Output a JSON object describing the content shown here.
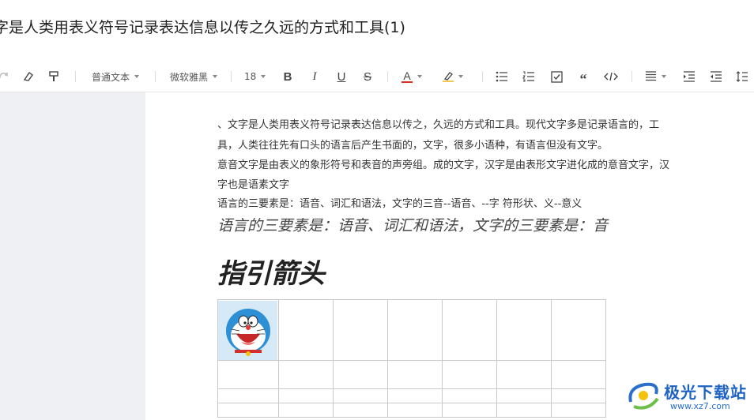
{
  "document": {
    "title": "字是人类用表义符号记录表达信息以传之久远的方式和工具(1)"
  },
  "toolbar": {
    "paragraph_style": "普通文本",
    "font_family": "微软雅黑",
    "font_size": "18",
    "icons": [
      "redo-icon",
      "eraser-icon",
      "format-painter-icon",
      "bold-icon",
      "italic-icon",
      "underline-icon",
      "strikethrough-icon",
      "font-color-icon",
      "highlight-icon",
      "bullet-list-icon",
      "numbered-list-icon",
      "checklist-icon",
      "quote-icon",
      "code-icon",
      "align-icon",
      "indent-icon",
      "outdent-icon",
      "line-height-icon"
    ],
    "accent_color": "#d93025"
  },
  "content": {
    "paragraphs": [
      "、文字是人类用表义符号记录表达信息以传之，久远的方式和工具。现代文字多是记录语言的，工",
      "具，人类往往先有口头的语言后产生书面的，文字，很多小语种，有语言但没有文字。",
      "意音文字是由表义的象形符号和表音的声旁组。成的文字，汉字是由表形文字进化成的意音文字，汉",
      "字也是语素文字",
      "语言的三要素是：语音、词汇和语法，文字的三音--语音、--字 符形状、义--意义"
    ],
    "italic_line": "语言的三要素是：语音、词汇和语法，文字的三要素是：音",
    "heading": "指引箭头"
  },
  "watermark": {
    "title": "极光下载站",
    "url": "www.xz7.com"
  }
}
